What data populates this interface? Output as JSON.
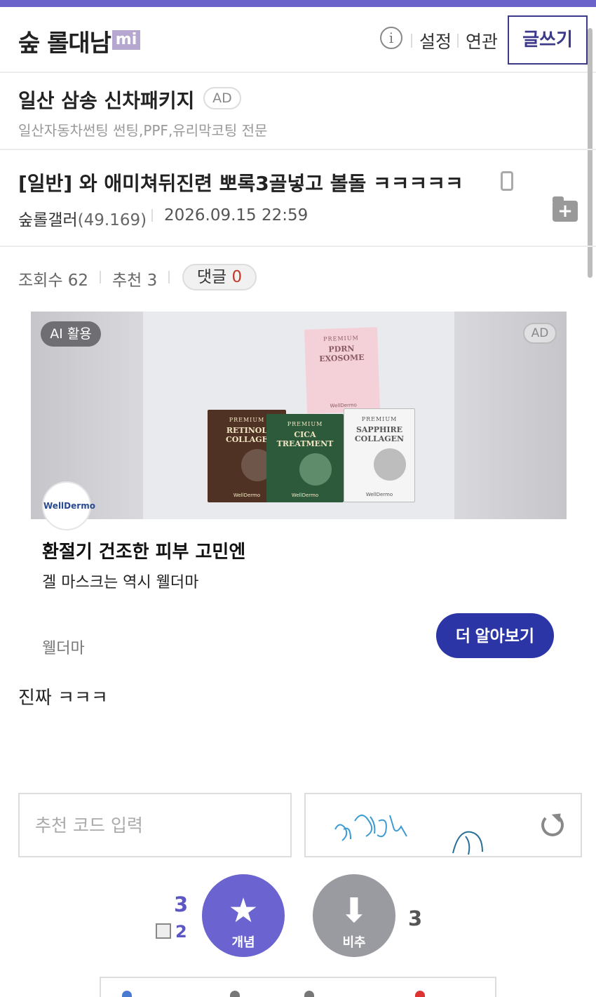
{
  "header": {
    "gallery_title": "숲 롤대남",
    "mi_badge": "mi",
    "info_icon": "info-icon",
    "settings_label": "설정",
    "related_label": "연관",
    "write_button": "글쓰기"
  },
  "top_ad": {
    "title": "일산 삼송 신차패키지",
    "ad_chip": "AD",
    "subtitle": "일산자동차썬팅 썬팅,PPF,유리막코팅 전문"
  },
  "post": {
    "title": "[일반] 와 애미쳐뒤진련 뽀록3골넣고 볼돌 ㅋㅋㅋㅋㅋ",
    "device_icon": "phone-icon",
    "author": "숲롤갤러",
    "author_ip": "(49.169)",
    "date": "2026.09.15 22:59",
    "folder_icon": "folder-add-icon",
    "views_label": "조회수 62",
    "recommend_label": "추천 3",
    "comments_label": "댓글",
    "comments_count": "0",
    "body": "진짜 ㅋㅋㅋ"
  },
  "ad_card": {
    "ai_chip": "AI 활용",
    "ad_tag": "AD",
    "brand_logo": "WellDermo",
    "headline": "환절기 건조한 피부 고민엔",
    "subline": "겔 마스크는 역시 웰더마",
    "brand_name": "웰더마",
    "cta": "더 알아보기",
    "packs": [
      {
        "premium": "PREMIUM",
        "name": "PDRN EXOSOME",
        "brand": "WellDermo"
      },
      {
        "premium": "PREMIUM",
        "name": "RETINOL COLLAGE",
        "brand": "WellDermo"
      },
      {
        "premium": "PREMIUM",
        "name": "CICA TREATMENT",
        "brand": "WellDermo"
      },
      {
        "premium": "PREMIUM",
        "name": "SAPPHIRE COLLAGEN",
        "brand": "WellDermo"
      }
    ]
  },
  "recommend_form": {
    "code_placeholder": "추천 코드 입력",
    "captcha_text": "뮤잉티 ㅅ",
    "refresh_icon": "refresh-icon"
  },
  "votes": {
    "up_count": "3",
    "fix_count": "2",
    "up_label": "개념",
    "down_label": "비추",
    "down_count": "3"
  },
  "colors": {
    "accent": "#6b63c9",
    "cta": "#2c35a5",
    "vote_up": "#6a63d0",
    "vote_down": "#9a9aa1",
    "comment_count": "#c0392b"
  }
}
